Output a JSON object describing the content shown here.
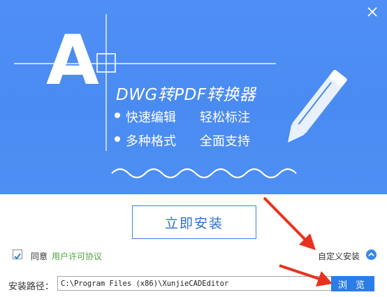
{
  "banner": {
    "title": "DWG转PDF转换器",
    "features": [
      "快速编辑",
      "轻松标注",
      "多种格式",
      "全面支持"
    ],
    "big_letter": "A"
  },
  "install_button": "立即安装",
  "agree": {
    "checked": true,
    "label": "同意",
    "link": "用户许可协议"
  },
  "custom_install": {
    "label": "自定义安装"
  },
  "install_path": {
    "label": "安装路径：",
    "value": "C:\\Program Files (x86)\\XunjieCADEditor"
  },
  "browse_button": "浏 览",
  "colors": {
    "banner": "#4b8cf2",
    "accent": "#2b7de9",
    "link": "#4aa53a",
    "arrow": "#e8321d"
  },
  "icons": {
    "close": "close-icon",
    "pen": "pen-icon",
    "check": "checkmark-icon",
    "chevron": "chevron-up-icon"
  }
}
